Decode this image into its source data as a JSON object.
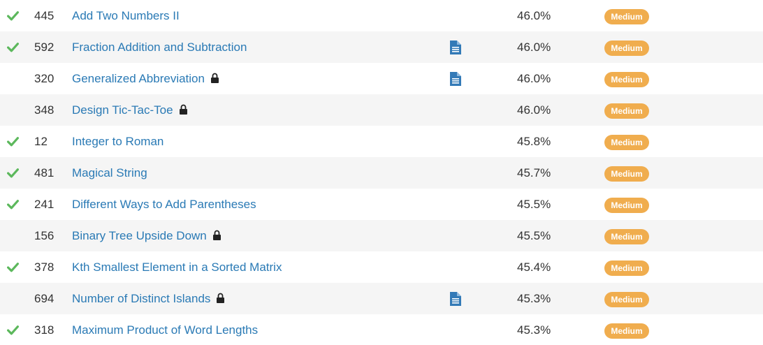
{
  "colors": {
    "link": "#2a7ab5",
    "check": "#5cb85c",
    "badge_medium": "#f0ad4e",
    "doc_icon": "#337ab7",
    "row_alt": "#f5f5f5"
  },
  "rows": [
    {
      "solved": true,
      "id": "445",
      "title": "Add Two Numbers II",
      "locked": false,
      "solution": false,
      "acceptance": "46.0%",
      "difficulty": "Medium"
    },
    {
      "solved": true,
      "id": "592",
      "title": "Fraction Addition and Subtraction",
      "locked": false,
      "solution": true,
      "acceptance": "46.0%",
      "difficulty": "Medium"
    },
    {
      "solved": false,
      "id": "320",
      "title": "Generalized Abbreviation",
      "locked": true,
      "solution": true,
      "acceptance": "46.0%",
      "difficulty": "Medium"
    },
    {
      "solved": false,
      "id": "348",
      "title": "Design Tic-Tac-Toe",
      "locked": true,
      "solution": false,
      "acceptance": "46.0%",
      "difficulty": "Medium"
    },
    {
      "solved": true,
      "id": "12",
      "title": "Integer to Roman",
      "locked": false,
      "solution": false,
      "acceptance": "45.8%",
      "difficulty": "Medium"
    },
    {
      "solved": true,
      "id": "481",
      "title": "Magical String",
      "locked": false,
      "solution": false,
      "acceptance": "45.7%",
      "difficulty": "Medium"
    },
    {
      "solved": true,
      "id": "241",
      "title": "Different Ways to Add Parentheses",
      "locked": false,
      "solution": false,
      "acceptance": "45.5%",
      "difficulty": "Medium"
    },
    {
      "solved": false,
      "id": "156",
      "title": "Binary Tree Upside Down",
      "locked": true,
      "solution": false,
      "acceptance": "45.5%",
      "difficulty": "Medium"
    },
    {
      "solved": true,
      "id": "378",
      "title": "Kth Smallest Element in a Sorted Matrix",
      "locked": false,
      "solution": false,
      "acceptance": "45.4%",
      "difficulty": "Medium"
    },
    {
      "solved": false,
      "id": "694",
      "title": "Number of Distinct Islands",
      "locked": true,
      "solution": true,
      "acceptance": "45.3%",
      "difficulty": "Medium"
    },
    {
      "solved": true,
      "id": "318",
      "title": "Maximum Product of Word Lengths",
      "locked": false,
      "solution": false,
      "acceptance": "45.3%",
      "difficulty": "Medium"
    }
  ]
}
